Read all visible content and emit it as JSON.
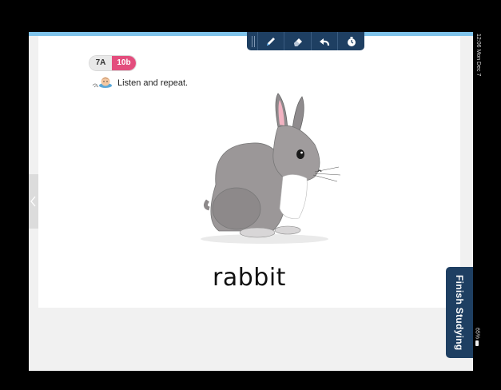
{
  "badge": {
    "unit": "7A",
    "lesson": "10b"
  },
  "instruction": {
    "text": "Listen and repeat.",
    "icon": "listening-character-icon"
  },
  "main": {
    "word": "rabbit",
    "image": "rabbit-illustration"
  },
  "toolbar": {
    "tools": [
      "pen-icon",
      "eraser-icon",
      "undo-icon",
      "timer-icon"
    ],
    "color": "#1e3f62"
  },
  "finish_button": {
    "label": "Finish Studying"
  },
  "status_bar": {
    "time": "12:06",
    "date": "Mon Dec 7",
    "battery": "65%"
  },
  "colors": {
    "accent_pink": "#e34d7d",
    "top_strip": "#7fc3ea",
    "background": "#f1f1f1"
  }
}
